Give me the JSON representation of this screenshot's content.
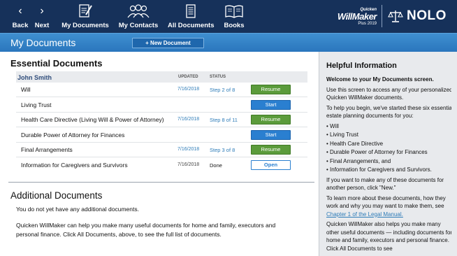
{
  "toolbar": {
    "back": "Back",
    "next": "Next",
    "my_documents": "My Documents",
    "my_contacts": "My Contacts",
    "all_documents": "All Documents",
    "books": "Books"
  },
  "brand": {
    "quicken": "Quicken",
    "willmaker": "WillMaker",
    "plus": "Plus 2019",
    "nolo": "NOLO"
  },
  "titlebar": {
    "title": "My Documents",
    "new_document": "+ New Document"
  },
  "essential": {
    "heading": "Essential Documents",
    "owner": "John Smith",
    "col_updated": "UPDATED",
    "col_status": "STATUS",
    "rows": [
      {
        "name": "Will",
        "updated": "7/16/2018",
        "status": "Step 2 of 8",
        "action": "Resume"
      },
      {
        "name": "Living Trust",
        "updated": "",
        "status": "",
        "action": "Start"
      },
      {
        "name": "Health Care Directive (Living Will & Power of Attorney)",
        "updated": "7/16/2018",
        "status": "Step 8 of 11",
        "action": "Resume"
      },
      {
        "name": "Durable Power of Attorney for Finances",
        "updated": "",
        "status": "",
        "action": "Start"
      },
      {
        "name": "Final Arrangements",
        "updated": "7/16/2018",
        "status": "Step 3 of 8",
        "action": "Resume"
      },
      {
        "name": "Information for Caregivers and Survivors",
        "updated": "7/16/2018",
        "status": "Done",
        "action": "Open"
      }
    ]
  },
  "additional": {
    "heading": "Additional Documents",
    "empty_text": "You do not yet have any additional documents.",
    "help_text": "Quicken WillMaker can help you make many useful documents for home and family, executors and personal finance. Click All Documents, above, to see the full list of documents."
  },
  "side": {
    "title": "Helpful Information",
    "welcome": "Welcome to your My Documents screen.",
    "p1": "Use this screen to access any of your personalized Quicken WillMaker documents.",
    "p2": "To help you begin, we've started these six essential estate planning documents for you:",
    "bullets": [
      "• Will",
      "• Living Trust",
      "• Health Care Directive",
      "• Durable Power of Attorney for Finances",
      "• Final Arrangements, and",
      "• Information for Caregivers and Survivors."
    ],
    "p3": "If you want to make any of these documents for another person, click \"New.\"",
    "p4_pre": "To learn more about these documents, how they work and why you may want to make them, see ",
    "p4_link": "Chapter 1 of the Legal Manual.",
    "p5": "Quicken WillMaker also helps you make many other useful documents — including documents for home and family, executors and personal finance. Click All Documents to see"
  },
  "colors": {
    "toolbar": "#16315a",
    "titlebar": "#2a76bd",
    "resume": "#5b9b3b",
    "start": "#2a7fd0",
    "link": "#2e7cb8"
  }
}
